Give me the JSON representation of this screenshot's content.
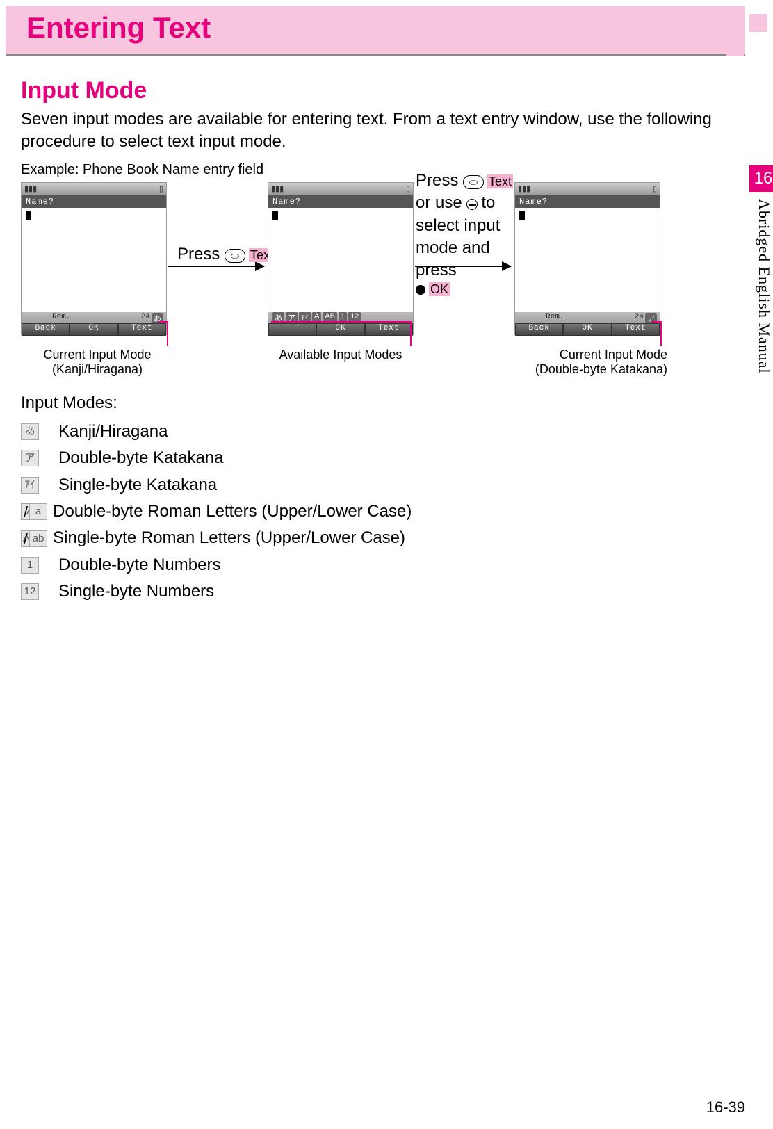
{
  "page": {
    "title": "Entering Text",
    "section": "Input Mode",
    "intro": "Seven input modes are available for entering text. From a text entry window, use the following procedure to select text input mode.",
    "example_label": "Example: Phone Book Name entry field",
    "footer": "16-39"
  },
  "side_tab": {
    "chapter": "16",
    "label": "Abridged English Manual"
  },
  "phones": {
    "name_prompt": "Name?",
    "rem_label": "Rem.",
    "rem_value": "24",
    "softkeys": {
      "back": "Back",
      "ok": "OK",
      "text": "Text"
    }
  },
  "steps": {
    "s1_prefix": "Press ",
    "s1_key": "⌒",
    "s1_hl": "Text",
    "s2_line1_prefix": "Press ",
    "s2_line1_hl": "Text",
    "s2_line2_a": "or use ",
    "s2_line2_b": " to",
    "s2_line3": "select input",
    "s2_line4": "mode and press",
    "s2_line5_hl": "OK"
  },
  "callouts": {
    "c1a": "Current Input Mode",
    "c1b": "(Kanji/Hiragana)",
    "c2": "Available Input Modes",
    "c3a": "Current Input Mode",
    "c3b": "(Double-byte Katakana)"
  },
  "modes": {
    "heading": "Input Modes:",
    "items": [
      {
        "icons": [
          "あ"
        ],
        "label": "Kanji/Hiragana"
      },
      {
        "icons": [
          "ア"
        ],
        "label": "Double-byte Katakana"
      },
      {
        "icons": [
          "ｱｲ"
        ],
        "label": "Single-byte Katakana"
      },
      {
        "icons": [
          "A",
          "a"
        ],
        "label": "Double-byte Roman Letters (Upper/Lower Case)"
      },
      {
        "icons": [
          "AB",
          "ab"
        ],
        "label": "Single-byte Roman Letters (Upper/Lower Case)"
      },
      {
        "icons": [
          "1"
        ],
        "label": "Double-byte Numbers"
      },
      {
        "icons": [
          "12"
        ],
        "label": "Single-byte Numbers"
      }
    ]
  },
  "mode_badges": {
    "hiragana": "あ",
    "katakana": "ア",
    "strip": [
      "あ",
      "ア",
      "ｱｲ",
      "A",
      "AB",
      "1",
      "12"
    ]
  }
}
